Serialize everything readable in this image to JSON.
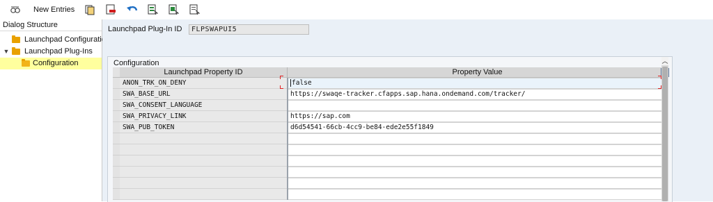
{
  "toolbar": {
    "new_entries_label": "New Entries"
  },
  "dialog": {
    "title": "Dialog Structure",
    "items": [
      {
        "label": "Launchpad Configuration"
      },
      {
        "label": "Launchpad Plug-Ins"
      },
      {
        "label": "Configuration"
      }
    ]
  },
  "plugin": {
    "label": "Launchpad Plug-In ID",
    "value": "FLPSWAPUI5"
  },
  "config": {
    "title": "Configuration",
    "columns": [
      "Launchpad Property ID",
      "Property Value"
    ],
    "rows": [
      {
        "id": "ANON_TRK_ON_DENY",
        "value": "false"
      },
      {
        "id": "SWA_BASE_URL",
        "value": "https://swaqe-tracker.cfapps.sap.hana.ondemand.com/tracker/"
      },
      {
        "id": "SWA_CONSENT_LANGUAGE",
        "value": ""
      },
      {
        "id": "SWA_PRIVACY_LINK",
        "value": "https://sap.com"
      },
      {
        "id": "SWA_PUB_TOKEN",
        "value": "d6d54541-66cb-4cc9-be84-ede2e55f1849"
      }
    ]
  }
}
